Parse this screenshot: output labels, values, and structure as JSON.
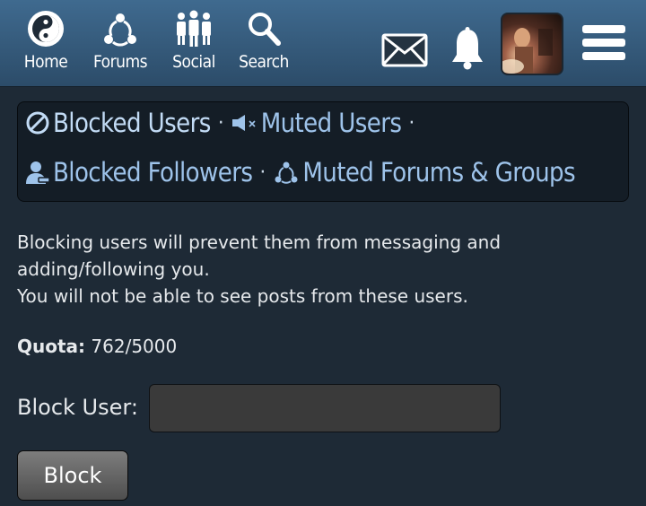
{
  "nav": {
    "home": "Home",
    "forums": "Forums",
    "social": "Social",
    "search": "Search"
  },
  "icons": {
    "home": "yin-yang-icon",
    "forums": "people-network-icon",
    "social": "people-group-icon",
    "search": "magnifier-icon",
    "messages": "envelope-icon",
    "notifications": "bell-icon",
    "menu": "hamburger-menu-icon",
    "blocked_users": "block-icon",
    "muted_users": "muted-speaker-icon",
    "blocked_followers": "user-minus-icon",
    "muted_forums": "muted-network-icon"
  },
  "tabs": {
    "blocked_users": "Blocked Users",
    "muted_users": "Muted Users",
    "blocked_followers": "Blocked Followers",
    "muted_forums": "Muted Forums & Groups",
    "separator": "·"
  },
  "description": {
    "line1": "Blocking users will prevent them from messaging and adding/following you.",
    "line2": "You will not be able to see posts from these users."
  },
  "quota": {
    "label": "Quota:",
    "value": "762/5000"
  },
  "block_form": {
    "label": "Block User:",
    "value": "",
    "button": "Block"
  },
  "colors": {
    "header": "#35597a",
    "background": "#1e2a36",
    "link": "#9ec3ea",
    "tab_box": "#141d26",
    "button": "#5f5f5f"
  }
}
